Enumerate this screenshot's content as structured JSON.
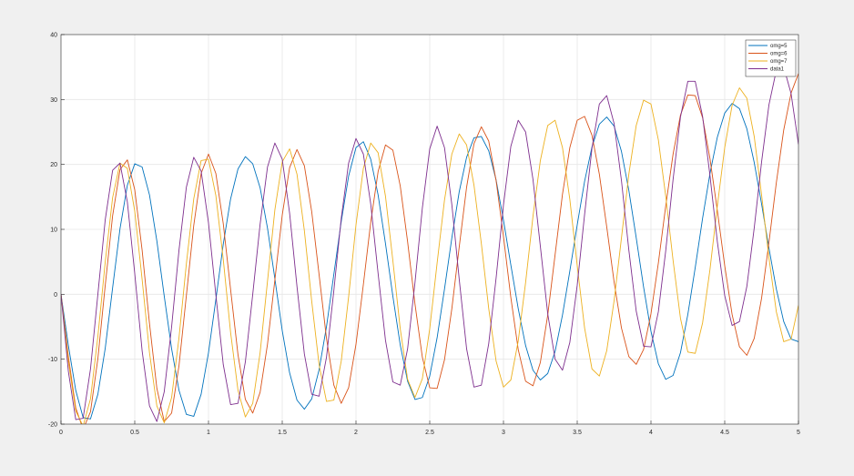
{
  "figure": {
    "background": "#f0f0f0",
    "axes_background": "#ffffff"
  },
  "chart_data": {
    "type": "line",
    "title": "",
    "xlabel": "",
    "ylabel": "",
    "xlim": [
      0,
      5
    ],
    "ylim": [
      -20,
      40
    ],
    "grid": true,
    "legend_position": "top-right",
    "x_ticks": [
      0,
      0.5,
      1,
      1.5,
      2,
      2.5,
      3,
      3.5,
      4,
      4.5,
      5
    ],
    "x_tick_labels": [
      "0",
      "0.5",
      "1",
      "1.5",
      "2",
      "2.5",
      "3",
      "3.5",
      "4",
      "4.5",
      "5"
    ],
    "y_ticks": [
      -20,
      -10,
      0,
      10,
      20,
      30,
      40
    ],
    "y_tick_labels": [
      "-20",
      "-10",
      "0",
      "10",
      "20",
      "30",
      "40"
    ],
    "x_step": 0.05,
    "series": [
      {
        "name": "omg=5",
        "color": "#0072bd",
        "values": [
          0.0,
          -7.9,
          -14.8,
          -19.0,
          -19.2,
          -15.4,
          -8.3,
          1.0,
          10.1,
          16.8,
          20.1,
          19.6,
          15.3,
          8.2,
          -0.3,
          -8.4,
          -14.8,
          -18.5,
          -18.8,
          -15.4,
          -9.0,
          -0.8,
          7.7,
          14.7,
          19.3,
          21.2,
          20.1,
          16.4,
          10.2,
          2.4,
          -5.6,
          -12.1,
          -16.3,
          -17.7,
          -16.1,
          -11.6,
          -5.0,
          3.1,
          11.2,
          18.2,
          22.6,
          23.5,
          20.8,
          15.3,
          7.8,
          -0.3,
          -7.8,
          -13.4,
          -16.2,
          -15.9,
          -12.6,
          -6.7,
          0.8,
          8.7,
          15.8,
          21.1,
          24.1,
          24.3,
          22.1,
          17.6,
          11.4,
          4.5,
          -2.2,
          -7.9,
          -11.7,
          -13.2,
          -12.2,
          -8.8,
          -3.2,
          3.6,
          10.7,
          17.4,
          22.7,
          26.2,
          27.3,
          25.9,
          22.0,
          16.0,
          8.7,
          1.1,
          -5.7,
          -10.7,
          -13.1,
          -12.5,
          -9.0,
          -3.1,
          4.1,
          11.7,
          18.6,
          24.2,
          27.9,
          29.4,
          28.6,
          25.5,
          20.3,
          13.9,
          7.1,
          0.8,
          -4.2,
          -6.9,
          -7.3
        ]
      },
      {
        "name": "omg=6",
        "color": "#d95319",
        "values": [
          0.0,
          -9.6,
          -17.5,
          -20.8,
          -18.1,
          -9.9,
          1.4,
          12.1,
          19.2,
          20.7,
          16.1,
          6.8,
          -4.5,
          -14.5,
          -19.6,
          -18.3,
          -11.0,
          -0.2,
          10.6,
          18.6,
          21.6,
          18.6,
          10.9,
          0.7,
          -9.3,
          -16.2,
          -18.3,
          -15.1,
          -7.7,
          2.2,
          12.2,
          19.5,
          22.3,
          19.8,
          12.7,
          3.0,
          -6.8,
          -14.0,
          -16.8,
          -14.4,
          -7.7,
          1.5,
          11.1,
          18.9,
          23.0,
          22.2,
          16.7,
          8.1,
          -1.5,
          -9.7,
          -14.4,
          -14.5,
          -10.1,
          -2.2,
          7.3,
          16.5,
          23.2,
          25.8,
          23.6,
          17.5,
          8.9,
          -0.5,
          -8.5,
          -13.4,
          -14.1,
          -10.5,
          -3.2,
          6.1,
          15.4,
          22.6,
          26.8,
          27.4,
          24.5,
          18.5,
          10.4,
          1.9,
          -5.2,
          -9.6,
          -10.8,
          -8.5,
          -3.0,
          4.8,
          13.6,
          21.6,
          27.6,
          30.7,
          30.6,
          27.2,
          20.9,
          12.9,
          4.4,
          -3.1,
          -8.1,
          -9.4,
          -6.8,
          -0.6,
          8.0,
          17.2,
          25.3,
          31.0,
          34.0
        ]
      },
      {
        "name": "omg=7",
        "color": "#edb120",
        "values": [
          0.0,
          -10.4,
          -18.0,
          -20.3,
          -16.1,
          -6.5,
          5.0,
          14.9,
          20.2,
          19.4,
          12.8,
          2.3,
          -9.0,
          -17.2,
          -19.8,
          -15.9,
          -6.7,
          4.7,
          14.7,
          20.6,
          20.8,
          15.2,
          5.4,
          -5.9,
          -14.8,
          -18.9,
          -16.8,
          -9.0,
          2.0,
          13.0,
          20.4,
          22.4,
          18.5,
          9.8,
          -1.1,
          -10.9,
          -16.5,
          -16.3,
          -10.3,
          -0.4,
          10.7,
          19.4,
          23.3,
          21.8,
          15.1,
          5.2,
          -5.3,
          -13.1,
          -15.9,
          -13.0,
          -5.3,
          4.8,
          14.5,
          21.6,
          24.7,
          23.0,
          16.8,
          7.8,
          -2.2,
          -10.3,
          -14.3,
          -13.2,
          -7.2,
          1.8,
          12.0,
          20.6,
          26.0,
          26.8,
          22.6,
          14.6,
          4.4,
          -5.2,
          -11.5,
          -12.6,
          -8.7,
          -1.0,
          8.7,
          18.5,
          26.0,
          29.9,
          29.3,
          23.8,
          15.1,
          5.2,
          -3.7,
          -8.9,
          -9.1,
          -4.4,
          3.8,
          13.6,
          22.6,
          29.1,
          31.8,
          30.2,
          24.3,
          15.3,
          5.6,
          -2.7,
          -7.3,
          -6.9,
          -1.7
        ]
      },
      {
        "name": "data1",
        "color": "#7e2f8e",
        "values": [
          0.0,
          -11.9,
          -19.3,
          -19.1,
          -11.5,
          0.0,
          11.5,
          19.1,
          20.2,
          14.2,
          3.2,
          -8.7,
          -17.2,
          -19.6,
          -15.0,
          -5.0,
          6.8,
          16.5,
          21.1,
          19.0,
          11.0,
          -0.1,
          -10.8,
          -17.0,
          -16.8,
          -10.4,
          0.0,
          10.8,
          19.6,
          23.3,
          20.8,
          12.5,
          1.2,
          -9.2,
          -15.4,
          -15.7,
          -9.7,
          0.6,
          11.7,
          20.2,
          24.0,
          21.6,
          13.9,
          3.2,
          -7.1,
          -13.5,
          -14.0,
          -8.4,
          1.8,
          13.3,
          22.4,
          25.9,
          22.6,
          13.8,
          2.3,
          -8.4,
          -14.3,
          -14.0,
          -7.6,
          2.5,
          13.8,
          22.8,
          26.8,
          25.0,
          17.7,
          7.4,
          -3.0,
          -10.0,
          -11.7,
          -7.4,
          1.4,
          12.3,
          22.5,
          29.3,
          30.6,
          26.3,
          17.5,
          6.8,
          -2.6,
          -8.0,
          -8.1,
          -2.7,
          6.7,
          17.7,
          27.3,
          32.8,
          32.8,
          27.4,
          18.3,
          8.1,
          -0.2,
          -4.8,
          -4.2,
          1.2,
          10.2,
          20.4,
          29.2,
          34.5,
          35.0,
          30.9,
          23.1
        ]
      }
    ]
  }
}
